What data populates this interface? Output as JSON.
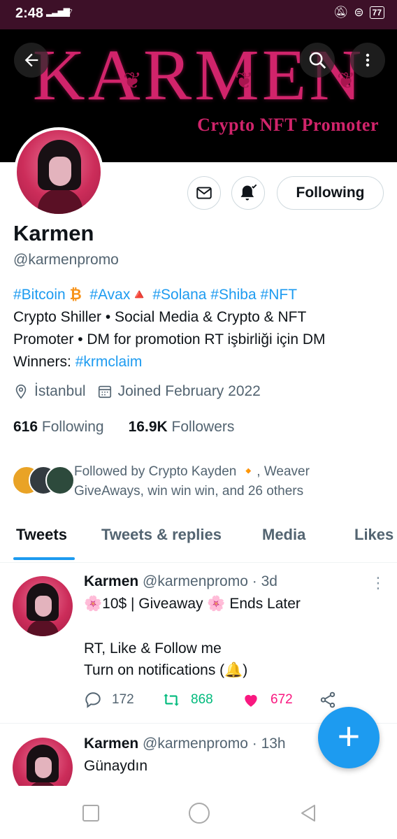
{
  "status_bar": {
    "time": "2:48",
    "battery": "77"
  },
  "banner": {
    "title": "KARMEN",
    "subtitle": "Crypto NFT Promoter"
  },
  "header_buttons": {
    "back_icon": "arrow-left-icon",
    "search_icon": "search-icon",
    "more_icon": "more-vertical-icon"
  },
  "profile": {
    "follow_button": "Following",
    "name": "Karmen",
    "handle": "@karmenpromo",
    "bio": {
      "tag_bitcoin": "#Bitcoin",
      "emoji_bitcoin": "₿",
      "tag_avax": "#Avax",
      "emoji_avax": "🔺",
      "tag_solana": "#Solana",
      "tag_shiba": "#Shiba",
      "tag_nft": "#NFT",
      "line2": "Crypto Shiller • Social Media & Crypto & NFT",
      "line3": "Promoter • DM for promotion  RT işbirliği için DM",
      "winners_label": "Winners: ",
      "winners_tag": "#krmclaim"
    },
    "location": "İstanbul",
    "joined": "Joined February 2022",
    "following_count": "616",
    "following_label": "Following",
    "followers_count": "16.9K",
    "followers_label": "Followers",
    "followed_by_line1": "Followed by Crypto Kayden  🔸, Weaver",
    "followed_by_line2": "GiveAways, win win win, and 26 others"
  },
  "tabs": [
    {
      "label": "Tweets",
      "active": true
    },
    {
      "label": "Tweets & replies",
      "active": false
    },
    {
      "label": "Media",
      "active": false
    },
    {
      "label": "Likes",
      "active": false
    }
  ],
  "tweets": [
    {
      "author": "Karmen",
      "handle": "@karmenpromo · 3d",
      "line1": "🌸10$ |  Giveaway  🌸 Ends Later",
      "line2": "RT, Like & Follow me",
      "line3": "Turn on notifications (🔔)",
      "replies": "172",
      "retweets": "868",
      "likes": "672"
    },
    {
      "author": "Karmen",
      "handle": "@karmenpromo · 13h",
      "line1": "Günaydın"
    }
  ],
  "colors": {
    "accent": "#1d9bf0",
    "brand_pink": "#d1246b",
    "retweet_green": "#00ba7c",
    "like_pink": "#f91880",
    "status_bar_bg": "#3d1028"
  }
}
